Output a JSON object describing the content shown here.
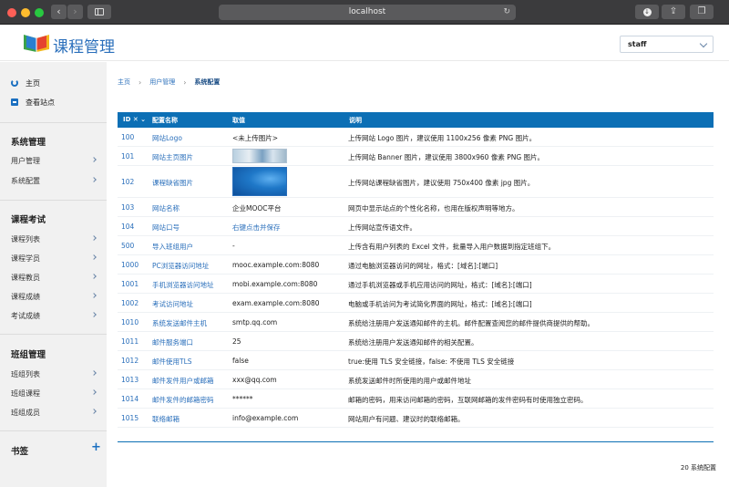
{
  "browser": {
    "url": "localhost"
  },
  "app": {
    "title": "课程管理",
    "role_select_value": "staff"
  },
  "sidebar": {
    "top_items": [
      {
        "label": "主页",
        "icon": "home-icon"
      },
      {
        "label": "查看站点",
        "icon": "view-site-icon"
      }
    ],
    "sections": [
      {
        "title": "系统管理",
        "items": [
          "用户管理",
          "系统配置"
        ]
      },
      {
        "title": "课程考试",
        "items": [
          "课程列表",
          "课程学员",
          "课程教员",
          "课程成绩",
          "考试成绩"
        ]
      },
      {
        "title": "班组管理",
        "items": [
          "班组列表",
          "班组课程",
          "班组成员"
        ]
      }
    ],
    "bookmarks_title": "书签",
    "bookmarks_add": "+"
  },
  "breadcrumb": {
    "items": [
      "主页",
      "用户管理",
      "系统配置"
    ]
  },
  "table": {
    "headers": {
      "id": "ID ✕ ⌄",
      "name": "配置名称",
      "value": "取值",
      "desc": "说明"
    },
    "rows": [
      {
        "id": "100",
        "name": "网站Logo",
        "value": "<未上传图片>",
        "value_type": "text",
        "desc": "上传网站 Logo 图片，建议使用 1100x256 像素 PNG 图片。"
      },
      {
        "id": "101",
        "name": "网站主页图片",
        "value": "",
        "value_type": "banner-image",
        "desc": "上传网站 Banner 图片，建议使用 3800x960 像素 PNG 图片。"
      },
      {
        "id": "102",
        "name": "课程缺省图片",
        "value": "",
        "value_type": "default-image",
        "desc": "上传网站课程缺省图片，建议使用 750x400 像素 jpg 图片。"
      },
      {
        "id": "103",
        "name": "网站名称",
        "value": "企业MOOC平台",
        "value_type": "text",
        "desc": "网页中显示站点的个性化名称，也用在版权声明等地方。"
      },
      {
        "id": "104",
        "name": "网站口号",
        "value": "右键点击并保存",
        "value_type": "link",
        "desc": "上传网站宣传语文件。"
      },
      {
        "id": "500",
        "name": "导入班组用户",
        "value": "-",
        "value_type": "text",
        "desc": "上传含有用户列表的 Excel 文件，批量导入用户数据到指定班组下。"
      },
      {
        "id": "1000",
        "name": "PC浏览器访问地址",
        "value": "mooc.example.com:8080",
        "value_type": "text",
        "desc": "通过电脑浏览器访问的网址，格式：[域名]:[端口]"
      },
      {
        "id": "1001",
        "name": "手机浏览器访问地址",
        "value": "mobi.example.com:8080",
        "value_type": "text",
        "desc": "通过手机浏览器或手机应用访问的网址，格式：[域名]:[端口]"
      },
      {
        "id": "1002",
        "name": "考试访问地址",
        "value": "exam.example.com:8080",
        "value_type": "text",
        "desc": "电脑或手机访问为考试简化界面的网址，格式：[域名]:[端口]"
      },
      {
        "id": "1010",
        "name": "系统发送邮件主机",
        "value": "smtp.qq.com",
        "value_type": "text",
        "desc": "系统给注册用户发送通知邮件的主机。邮件配置查阅您的邮件提供商提供的帮助。"
      },
      {
        "id": "1011",
        "name": "邮件服务端口",
        "value": "25",
        "value_type": "text",
        "desc": "系统给注册用户发送通知邮件的相关配置。"
      },
      {
        "id": "1012",
        "name": "邮件使用TLS",
        "value": "false",
        "value_type": "text",
        "desc": "true:使用 TLS 安全链接，false: 不使用 TLS 安全链接"
      },
      {
        "id": "1013",
        "name": "邮件发件用户或邮箱",
        "value": "xxx@qq.com",
        "value_type": "text",
        "desc": "系统发送邮件时所使用的用户或邮件地址"
      },
      {
        "id": "1014",
        "name": "邮件发件的邮箱密码",
        "value": "******",
        "value_type": "text",
        "desc": "邮箱的密码，用来访问邮箱的密码，互联网邮箱的发件密码有时使用独立密码。"
      },
      {
        "id": "1015",
        "name": "联络邮箱",
        "value": "info@example.com",
        "value_type": "text",
        "desc": "网站用户有问题、建议时的联络邮箱。"
      }
    ],
    "count_label": "20 系统配置"
  },
  "colors": {
    "accent": "#0c6fb5",
    "link": "#2a6fbb",
    "sidebar_bg": "#f1f1f1"
  }
}
